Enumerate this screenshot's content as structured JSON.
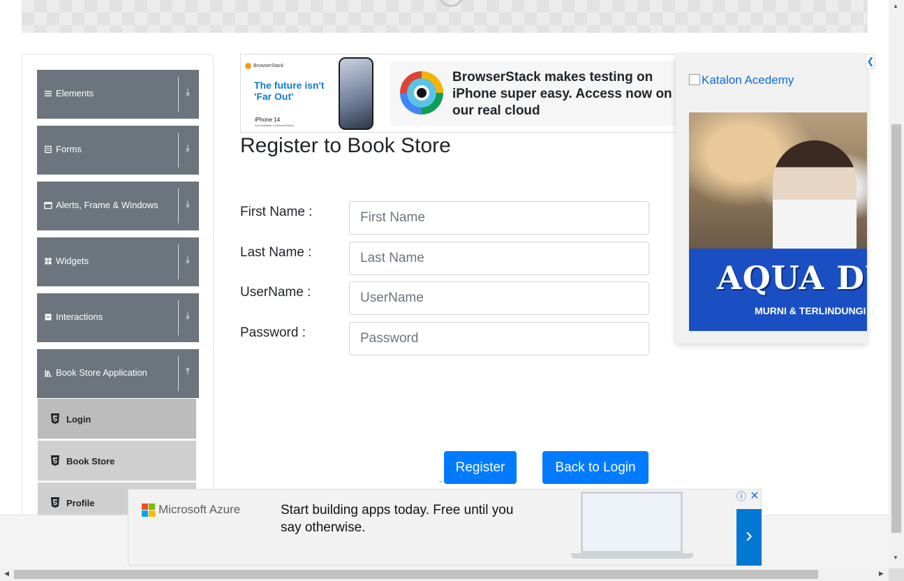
{
  "sidebar": {
    "groups": [
      {
        "label": "Elements",
        "icon": "menu-icon",
        "arrow": "⤓"
      },
      {
        "label": "Forms",
        "icon": "form-icon",
        "arrow": "⤓"
      },
      {
        "label": "Alerts, Frame & Windows",
        "icon": "window-icon",
        "arrow": "⤓"
      },
      {
        "label": "Widgets",
        "icon": "widgets-icon",
        "arrow": "⤓"
      },
      {
        "label": "Interactions",
        "icon": "interactions-icon",
        "arrow": "⤓"
      },
      {
        "label": "Book Store Application",
        "icon": "library-icon",
        "arrow": "⤒"
      }
    ],
    "items": [
      {
        "label": "Login",
        "icon": "html5-icon"
      },
      {
        "label": "Book Store",
        "icon": "html5-icon"
      },
      {
        "label": "Profile",
        "icon": "html5-icon"
      }
    ]
  },
  "top_ad": {
    "brand": "BrowserStack",
    "tagline": "The future isn't 'Far Out'",
    "product": "iPhone 14",
    "fine_print": "now available on BrowserStack",
    "text": "BrowserStack makes testing on iPhone super easy. Access now on our real cloud"
  },
  "form": {
    "title": "Register to Book Store",
    "fields": [
      {
        "label": "First Name :",
        "placeholder": "First Name"
      },
      {
        "label": "Last Name :",
        "placeholder": "Last Name"
      },
      {
        "label": "UserName :",
        "placeholder": "UserName"
      },
      {
        "label": "Password :",
        "placeholder": "Password"
      }
    ],
    "register_label": "Register",
    "back_label": "Back to Login"
  },
  "right_ad": {
    "image_alt": "Katalon Acedemy",
    "aqua_text": "AQUA DUI",
    "tagline": "MURNI & TERLINDUNGI",
    "close_glyph": "❮"
  },
  "bottom_ad": {
    "brand": "Microsoft Azure",
    "headline": "Start building apps today. Free until you say otherwise.",
    "next_glyph": "›",
    "info_glyph": "ⓘ",
    "close_glyph": "✕"
  },
  "colors": {
    "nav_group_bg": "#6c757d",
    "nav_item_bg": "#cfcfcf",
    "nav_item_active_bg": "#bcbcbc",
    "primary": "#007bff",
    "azure": "#0078d4"
  }
}
